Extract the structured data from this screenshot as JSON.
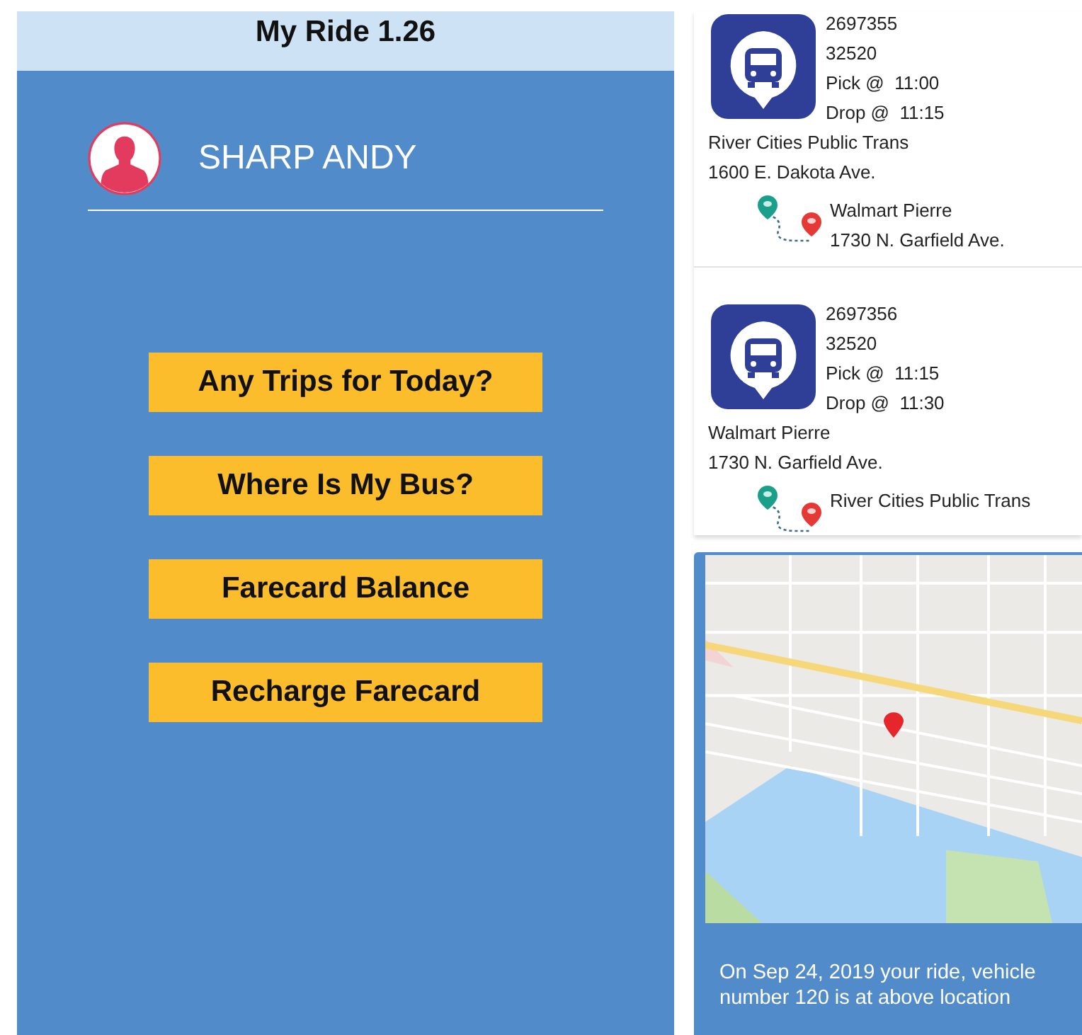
{
  "app": {
    "title": "My Ride 1.26"
  },
  "user": {
    "name": "SHARP ANDY"
  },
  "menu": [
    {
      "label": "Any Trips for Today?"
    },
    {
      "label": "Where Is My Bus?"
    },
    {
      "label": "Farecard Balance"
    },
    {
      "label": "Recharge Farecard"
    }
  ],
  "trips": [
    {
      "trip_id": "2697355",
      "client_id": "32520",
      "pick": "Pick @  11:00",
      "drop": "Drop @  11:15",
      "from_name": "River Cities Public Trans",
      "from_address": "1600 E. Dakota Ave.",
      "to_name": "Walmart Pierre",
      "to_address": "1730 N. Garfield Ave."
    },
    {
      "trip_id": "2697356",
      "client_id": "32520",
      "pick": "Pick @  11:15",
      "drop": "Drop @  11:30",
      "from_name": "Walmart Pierre",
      "from_address": "1730 N. Garfield Ave.",
      "to_name": "River Cities Public Trans"
    }
  ],
  "bus_location": {
    "message": "On Sep 24, 2019   your ride, vehicle number 120 is at above location"
  }
}
